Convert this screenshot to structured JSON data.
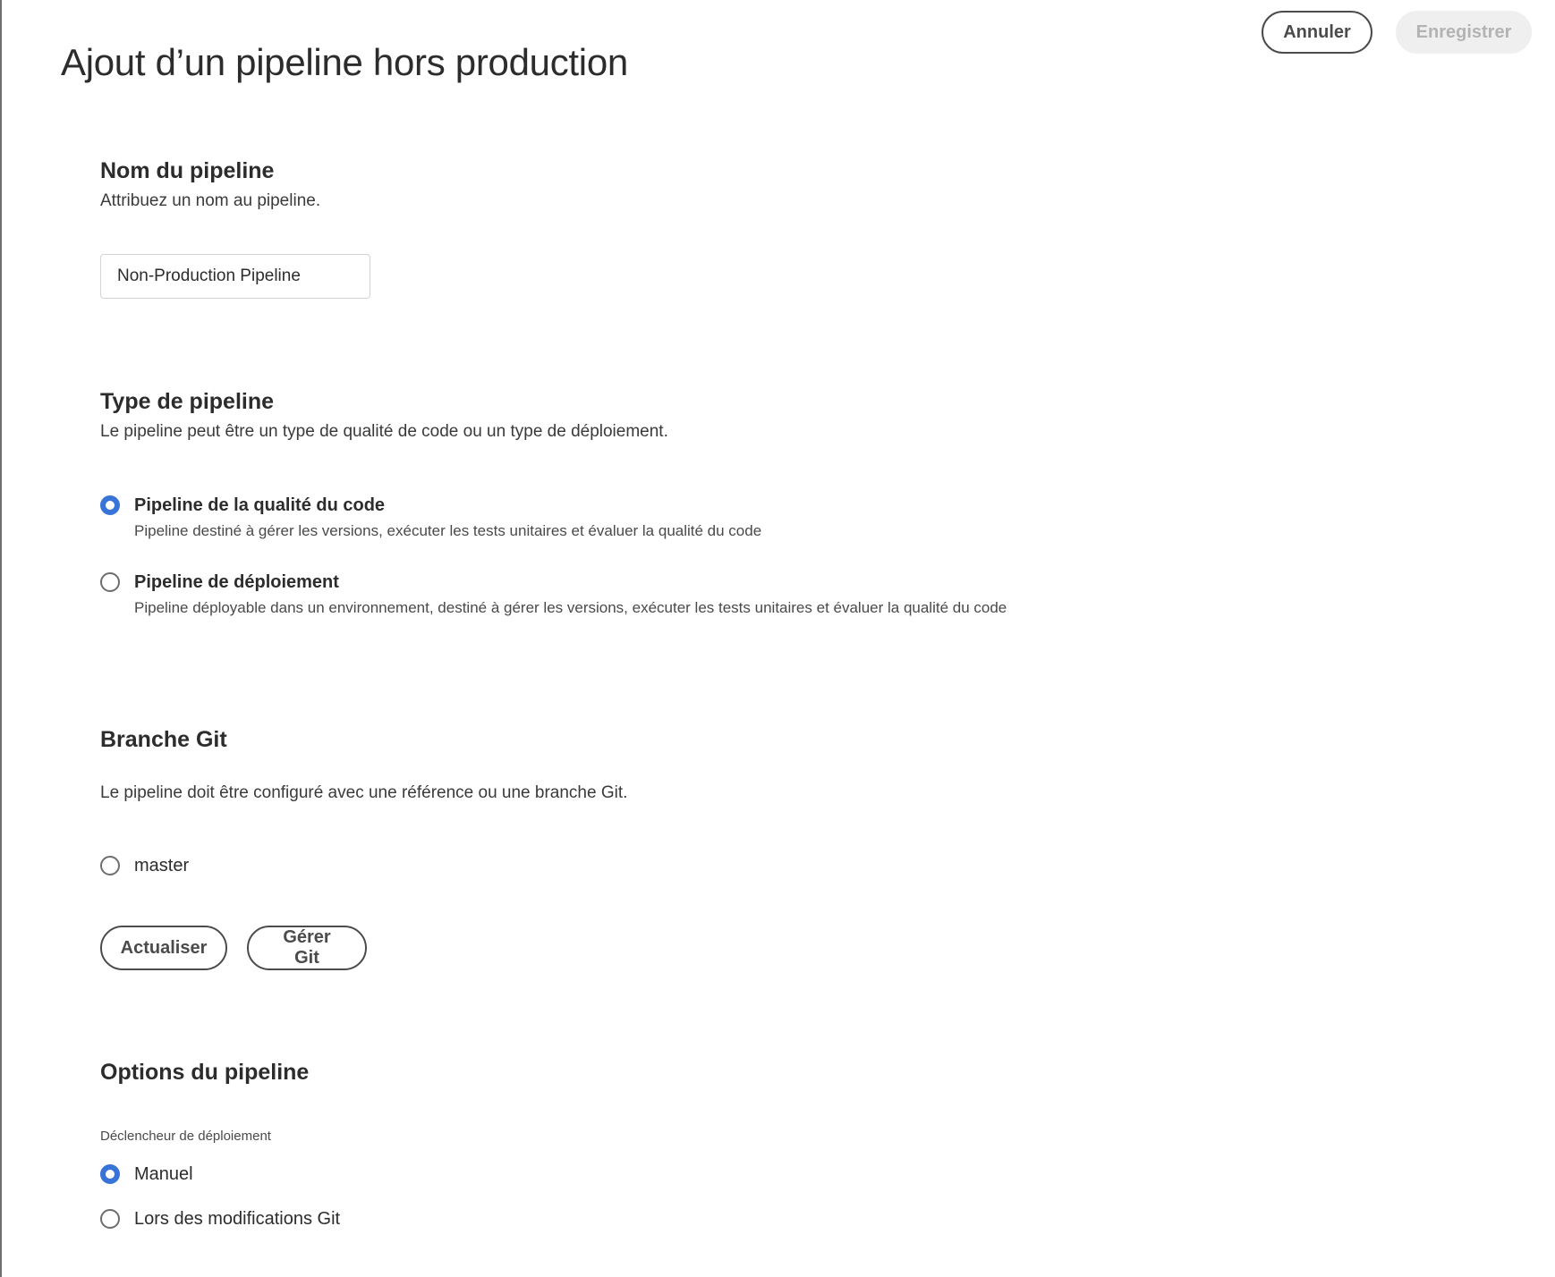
{
  "header": {
    "title": "Ajout d’un pipeline hors production",
    "cancel_label": "Annuler",
    "save_label": "Enregistrer"
  },
  "pipeline_name": {
    "title": "Nom du pipeline",
    "description": "Attribuez un nom au pipeline.",
    "value": "Non-Production Pipeline"
  },
  "pipeline_type": {
    "title": "Type de pipeline",
    "description": "Le pipeline peut être un type de qualité de code ou un type de déploiement.",
    "options": [
      {
        "label": "Pipeline de la qualité du code",
        "help": "Pipeline destiné à gérer les versions, exécuter les tests unitaires et évaluer la qualité du code",
        "checked": true
      },
      {
        "label": "Pipeline de déploiement",
        "help": "Pipeline déployable dans un environnement, destiné à gérer les versions, exécuter les tests unitaires et évaluer la qualité du code",
        "checked": false
      }
    ]
  },
  "git_branch": {
    "title": "Branche Git",
    "description": "Le pipeline doit être configuré avec une référence ou une branche Git.",
    "branches": [
      {
        "label": "master",
        "checked": false
      }
    ],
    "refresh_label": "Actualiser",
    "manage_label": "Gérer Git"
  },
  "pipeline_options": {
    "title": "Options du pipeline",
    "trigger_label": "Déclencheur de déploiement",
    "triggers": [
      {
        "label": "Manuel",
        "checked": true
      },
      {
        "label": "Lors des modifications Git",
        "checked": false
      }
    ]
  },
  "colors": {
    "accent": "#3874d8",
    "text": "#2c2c2c",
    "disabled_bg": "#efefef",
    "disabled_text": "#b3b3b3"
  }
}
